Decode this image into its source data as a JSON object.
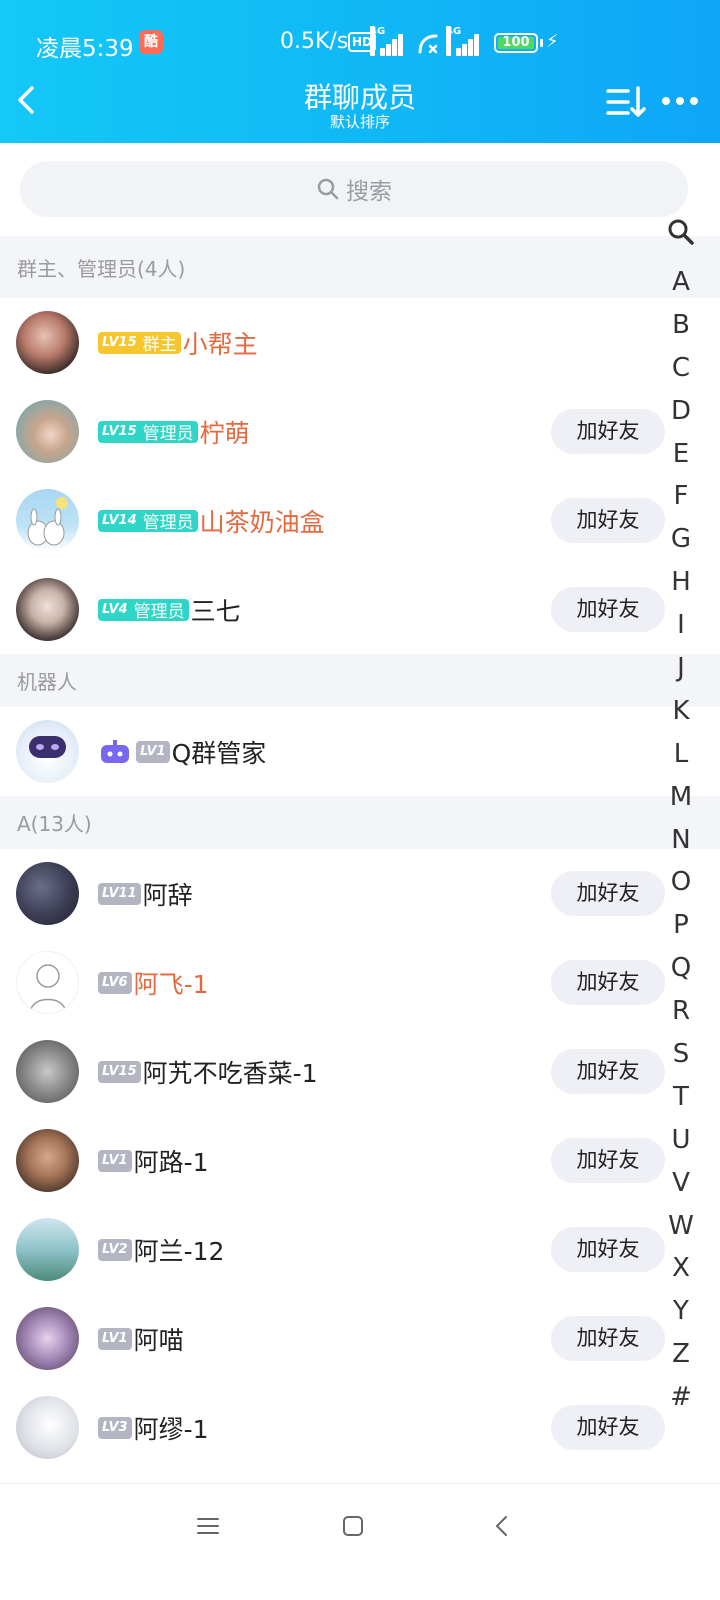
{
  "status_bar": {
    "time": "凌晨5:39",
    "app_badge": "酷",
    "net_speed": "0.5K/s",
    "hd": "HD",
    "sig1_tag": "4G",
    "sig2_tag": "4G",
    "battery": "100"
  },
  "nav": {
    "title": "群聊成员",
    "subtitle": "默认排序"
  },
  "search": {
    "placeholder": "搜索"
  },
  "sections": {
    "admins": "群主、管理员(4人)",
    "bots": "机器人",
    "a": "A(13人)"
  },
  "add_friend_label": "加好友",
  "members": [
    {
      "lv": "LV15",
      "role": "群主",
      "name": "小帮主",
      "highlight": true
    },
    {
      "lv": "LV15",
      "role": "管理员",
      "name": "柠萌",
      "highlight": true
    },
    {
      "lv": "LV14",
      "role": "管理员",
      "name": "山茶奶油盒",
      "highlight": true
    },
    {
      "lv": "LV4",
      "role": "管理员",
      "name": "三七",
      "highlight": false
    },
    {
      "lv": "LV1",
      "role": "",
      "name": "Q群管家",
      "highlight": false
    },
    {
      "lv": "LV11",
      "role": "",
      "name": "阿辞",
      "highlight": false
    },
    {
      "lv": "LV6",
      "role": "",
      "name": "阿飞-1",
      "highlight": true
    },
    {
      "lv": "LV15",
      "role": "",
      "name": "阿艽不吃香菜-1",
      "highlight": false
    },
    {
      "lv": "LV1",
      "role": "",
      "name": "阿路-1",
      "highlight": false
    },
    {
      "lv": "LV2",
      "role": "",
      "name": "阿兰-12",
      "highlight": false
    },
    {
      "lv": "LV1",
      "role": "",
      "name": "阿喵",
      "highlight": false
    },
    {
      "lv": "LV3",
      "role": "",
      "name": "阿缪-1",
      "highlight": false
    }
  ],
  "index_letters": [
    "A",
    "B",
    "C",
    "D",
    "E",
    "F",
    "G",
    "H",
    "I",
    "J",
    "K",
    "L",
    "M",
    "N",
    "O",
    "P",
    "Q",
    "R",
    "S",
    "T",
    "U",
    "V",
    "W",
    "X",
    "Y",
    "Z",
    "#"
  ],
  "colors": {
    "header_start": "#14c8f7",
    "header_end": "#0ea6f7",
    "owner_badge": "#f7c62f",
    "admin_badge": "#2fd5c6",
    "grey_badge": "#b3b6c2",
    "highlight_name": "#e36a3f"
  }
}
